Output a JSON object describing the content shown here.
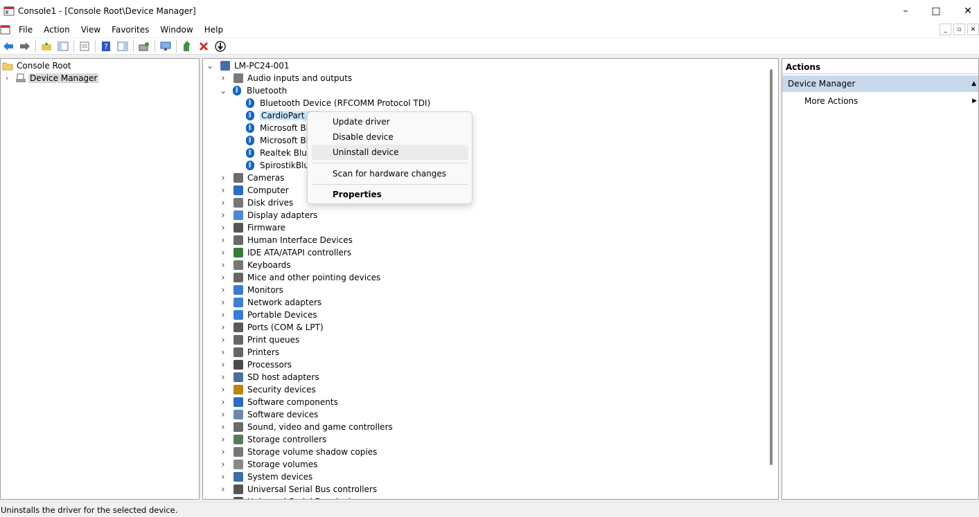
{
  "window": {
    "title": "Console1 - [Console Root\\Device Manager]",
    "minimize": "–",
    "maximize": "□",
    "close": "✕"
  },
  "menubar": [
    "File",
    "Action",
    "View",
    "Favorites",
    "Window",
    "Help"
  ],
  "left_tree": {
    "root": "Console Root",
    "child": "Device Manager"
  },
  "device_tree": {
    "computer": "LM-PC24-001",
    "bluetooth_children": [
      "Bluetooth Device (RFCOMM Protocol TDI)",
      "CardioPart 12",
      "Microsoft Blu",
      "Microsoft Blu",
      "Realtek Bluet",
      "SpirostikBlue"
    ],
    "categories_top": [
      "Audio inputs and outputs",
      "Bluetooth"
    ],
    "categories": [
      "Cameras",
      "Computer",
      "Disk drives",
      "Display adapters",
      "Firmware",
      "Human Interface Devices",
      "IDE ATA/ATAPI controllers",
      "Keyboards",
      "Mice and other pointing devices",
      "Monitors",
      "Network adapters",
      "Portable Devices",
      "Ports (COM & LPT)",
      "Print queues",
      "Printers",
      "Processors",
      "SD host adapters",
      "Security devices",
      "Software components",
      "Software devices",
      "Sound, video and game controllers",
      "Storage controllers",
      "Storage volume shadow copies",
      "Storage volumes",
      "System devices",
      "Universal Serial Bus controllers",
      "Universal Serial Bus devices"
    ]
  },
  "context_menu": {
    "update": "Update driver",
    "disable": "Disable device",
    "uninstall": "Uninstall device",
    "scan": "Scan for hardware changes",
    "properties": "Properties"
  },
  "actions": {
    "header": "Actions",
    "section": "Device Manager",
    "more": "More Actions"
  },
  "status": "Uninstalls the driver for the selected device.",
  "colors": {
    "selection": "#cce8ff",
    "actions_section": "#c9d9ec",
    "bluetooth": "#1565c0",
    "delete_red": "#d32f2f",
    "help_blue": "#2b57c4"
  }
}
